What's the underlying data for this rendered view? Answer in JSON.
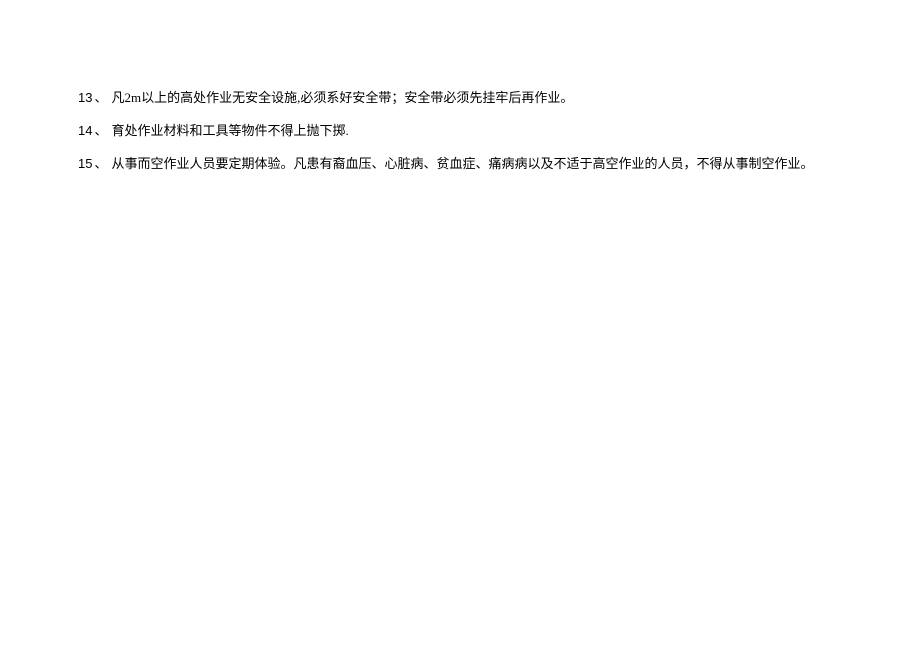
{
  "items": [
    {
      "number": "13",
      "separator": "、",
      "text": "凡2m以上的高处作业无安全设施,必须系好安全带；安全带必须先挂牢后再作业。"
    },
    {
      "number": "14",
      "separator": "、",
      "text": "育处作业材料和工具等物件不得上抛下掷."
    },
    {
      "number": "15",
      "separator": "、",
      "text": "从事而空作业人员要定期体验。凡患有裔血压、心脏病、贫血症、痛病病以及不适于高空作业的人员，不得从事制空作业。"
    }
  ]
}
